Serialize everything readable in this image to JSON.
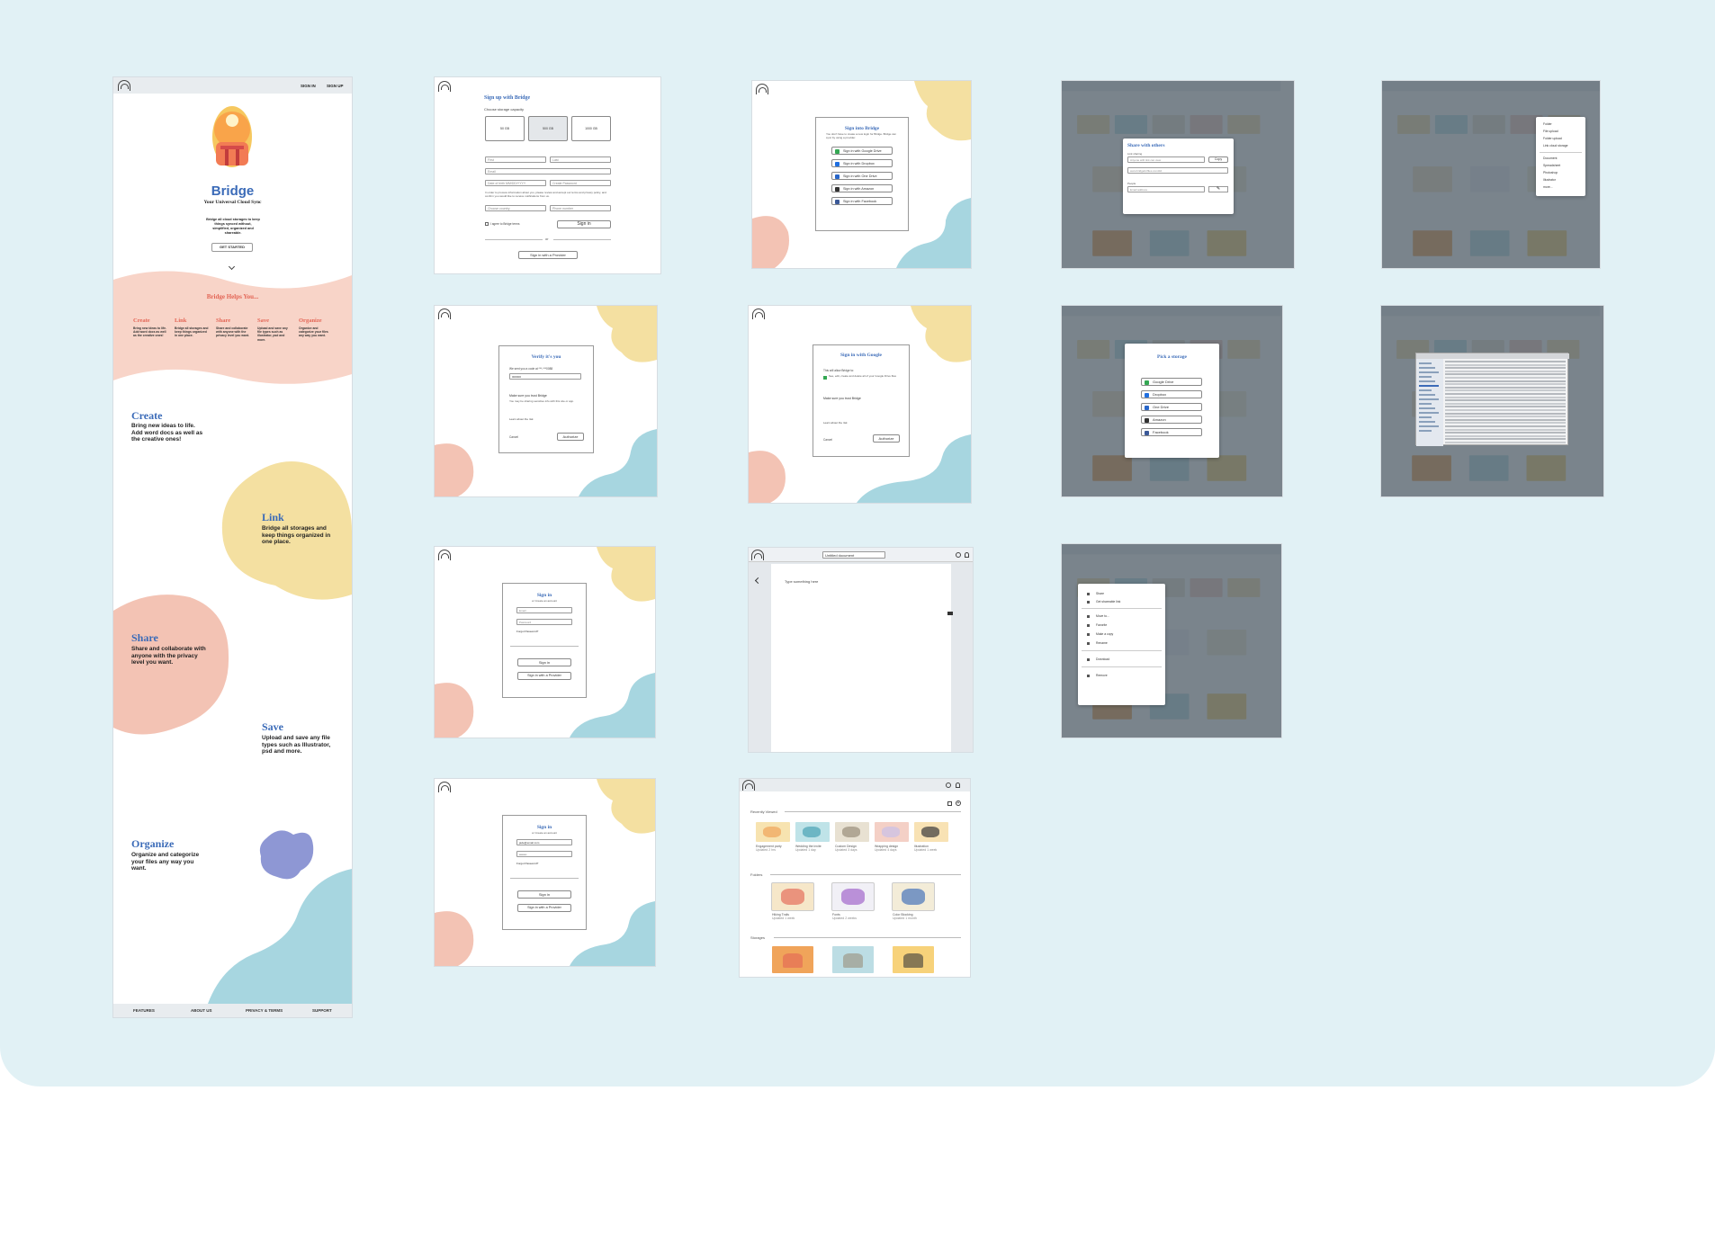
{
  "landing": {
    "nav": {
      "signin": "SIGN IN",
      "signup": "SIGN UP"
    },
    "brand": "Bridge",
    "tagline": "Your Universal Cloud Sync",
    "blurb": "Bridge all cloud storages to keep things synced without, simplified, organized and shareable.",
    "cta": "GET STARTED",
    "helps_title": "Bridge Helps You...",
    "helps": [
      {
        "title": "Create",
        "desc": "Bring new ideas to life. Add word docs as well as the creative ones!"
      },
      {
        "title": "Link",
        "desc": "Bridge all storages and keep things organized in one place."
      },
      {
        "title": "Share",
        "desc": "Share and collaborate with anyone with the privacy level you want."
      },
      {
        "title": "Save",
        "desc": "Upload and save any file types such as illustrator, psd and more."
      },
      {
        "title": "Organize",
        "desc": "Organize and categorize your files any way you want."
      }
    ],
    "features": [
      {
        "title": "Create",
        "desc": "Bring new ideas to life. Add word docs as well as the creative ones!"
      },
      {
        "title": "Link",
        "desc": "Bridge all storages and keep things organized in one place."
      },
      {
        "title": "Share",
        "desc": "Share and collaborate with anyone with the privacy level you want."
      },
      {
        "title": "Save",
        "desc": "Upload and save any file types such as Illustrator, psd and more."
      },
      {
        "title": "Organize",
        "desc": "Organize and categorize your files any way you want."
      }
    ],
    "footer": [
      "FEATURES",
      "ABOUT US",
      "PRIVACY & TERMS",
      "SUPPORT"
    ]
  },
  "signup": {
    "title": "Sign up with Bridge",
    "storage_label": "Choose storage capacity",
    "plans": [
      "50 GB",
      "500 GB",
      "1000 GB"
    ],
    "first": "First",
    "last": "Last",
    "email": "Email",
    "dob": "Date of birth MM/DD/YYYY",
    "password": "Create Password",
    "terms": "In order to process information about you, please review and accept our terms and privacy policy, and confirm you would like to receive notifications from us.",
    "country": "Choose country",
    "phone": "Phone number",
    "agree": "I agree to Bridge terms",
    "signin": "Sign in",
    "or": "or",
    "provider": "Sign in with a Provider"
  },
  "signin_providers": {
    "title": "Sign into Bridge",
    "desc": "You don't have to create a new login for Bridge. Bridge can sync by using a provider.",
    "providers": [
      {
        "label": "Sign in with Google Drive",
        "color": "#34a853"
      },
      {
        "label": "Sign in with Dropbox",
        "color": "#1f6fe0"
      },
      {
        "label": "Sign in with One Drive",
        "color": "#2866c9"
      },
      {
        "label": "Sign in with Amazon",
        "color": "#333333"
      },
      {
        "label": "Sign in with Facebook",
        "color": "#3b5998"
      }
    ]
  },
  "verify": {
    "title": "Verify it's you",
    "sent": "We sent you a code at ***-***0088",
    "code": "000000",
    "make_sure": "Make sure you trust Bridge",
    "note": "You may be sharing sensitive info with this site or app.",
    "learn": "Learn about the risk",
    "cancel": "Cancel",
    "authorize": "Authorize"
  },
  "google": {
    "title": "Sign in with Google",
    "will_allow": "This will allow Bridge to:",
    "perm": "See, edit, create and delete all of your Google Drive files",
    "make_sure": "Make sure you trust Bridge",
    "learn": "Learn about the risk",
    "cancel": "Cancel",
    "authorize": "Authorize"
  },
  "signin_form": {
    "title": "Sign in",
    "subtitle": "or Create an account",
    "email": "Email",
    "password": "Password",
    "forgot": "Forgot Password?",
    "signin": "Sign in",
    "provider": "Sign in with a Provider"
  },
  "signin_filled": {
    "title": "Sign in",
    "subtitle": "or Create an account",
    "email": "jade@email.com",
    "password": "••••••••",
    "forgot": "Forgot Password?",
    "signin": "Sign in",
    "provider": "Sign in with a Provider"
  },
  "document": {
    "title": "Untitled document",
    "body": "Type something here"
  },
  "dashboard": {
    "recent_label": "Recently Viewed",
    "recent": [
      {
        "name": "Engagement party",
        "meta": "Updated 2 hrs"
      },
      {
        "name": "Wedding the invite",
        "meta": "Updated 1 day"
      },
      {
        "name": "Custom Design",
        "meta": "Updated 3 days"
      },
      {
        "name": "Wrapping design",
        "meta": "Updated 4 days"
      },
      {
        "name": "Illustration",
        "meta": "Updated 1 week"
      }
    ],
    "folders_label": "Folders",
    "folders": [
      {
        "name": "Hiking Trails",
        "meta": "Updated 1 week"
      },
      {
        "name": "Fonts",
        "meta": "Updated 2 weeks"
      },
      {
        "name": "Color Blocking",
        "meta": "Updated 1 month"
      }
    ],
    "storages_label": "Storages"
  },
  "share": {
    "title": "Share with others",
    "link_label": "Link sharing",
    "link_option": "Anyone with link can view",
    "copy": "Copy",
    "url": "www.bridgeforfiles.com/dd",
    "people_label": "People",
    "email_placeholder": "Email address..."
  },
  "new_menu": {
    "items": [
      "Folder",
      "File upload",
      "Folder upload",
      "Link cloud storage",
      "Document",
      "Spreadsheet",
      "Photoshop",
      "Illustrator",
      "more..."
    ]
  },
  "pick": {
    "title": "Pick a storage",
    "options": [
      {
        "label": "Google Drive",
        "color": "#34a853"
      },
      {
        "label": "Dropbox",
        "color": "#1f6fe0"
      },
      {
        "label": "One Drive",
        "color": "#2866c9"
      },
      {
        "label": "Amazon",
        "color": "#333333"
      },
      {
        "label": "Facebook",
        "color": "#3b5998"
      }
    ]
  },
  "file_menu": {
    "items": [
      "Share",
      "Get shareable link",
      "Move to...",
      "Favorite",
      "Make a copy",
      "Rename",
      "Download",
      "Remove"
    ]
  },
  "colors": {
    "board": "#e1f1f5",
    "pink": "#f3c3b4",
    "yellow": "#f4e0a1",
    "teal": "#a7d6e0",
    "purple": "#8e97d4",
    "brand_blue": "#3b6bb8",
    "accent_red": "#e36555"
  }
}
